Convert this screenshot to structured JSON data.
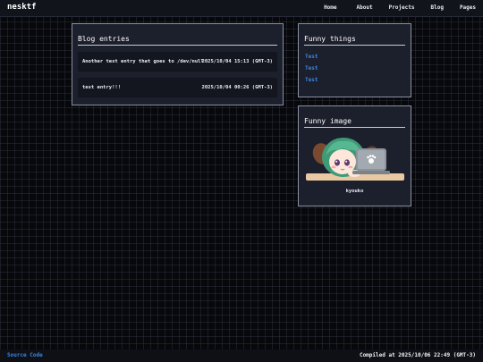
{
  "site": {
    "logo": "nesktf"
  },
  "nav": {
    "items": [
      {
        "label": "Home"
      },
      {
        "label": "About"
      },
      {
        "label": "Projects"
      },
      {
        "label": "Blog"
      },
      {
        "label": "Pages"
      }
    ]
  },
  "blog": {
    "title": "Blog entries",
    "entries": [
      {
        "title": "Another test entry that goes to /dev/null",
        "date": "2025/10/04 15:13 (GMT-3)"
      },
      {
        "title": "test entry!!!",
        "date": "2025/10/04 00:26 (GMT-3)"
      }
    ]
  },
  "funny_things": {
    "title": "Funny things",
    "links": [
      {
        "label": "Test"
      },
      {
        "label": "Test"
      },
      {
        "label": "Test"
      }
    ]
  },
  "funny_image": {
    "title": "Funny image",
    "caption": "kyouko"
  },
  "footer": {
    "source_link": "Source Code",
    "compiled": "Compiled at 2025/10/06 22:49 (GMT-3)"
  },
  "colors": {
    "background": "#07080b",
    "panel": "#1c1f2c",
    "link": "#3b86e0",
    "text": "#e9ecf4"
  }
}
